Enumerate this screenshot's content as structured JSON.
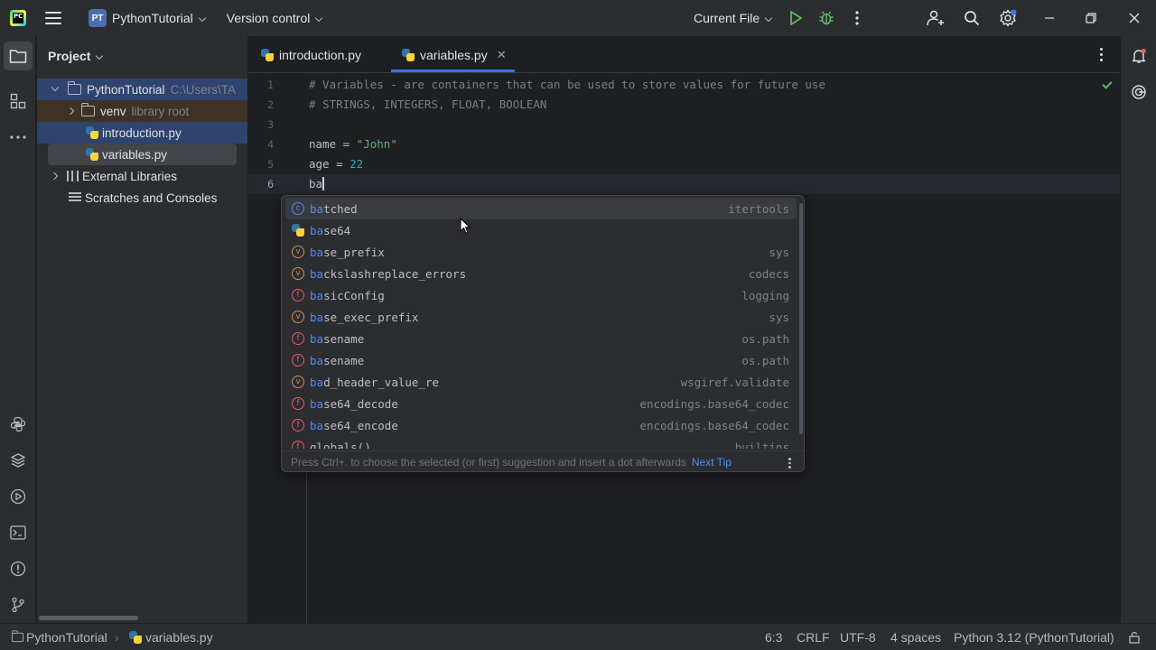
{
  "titlebar": {
    "app_logo_text": "PC",
    "project_badge": "PT",
    "project_name": "PythonTutorial",
    "vcs_label": "Version control",
    "run_config": "Current File"
  },
  "project_panel": {
    "title": "Project",
    "tree": [
      {
        "label": "PythonTutorial",
        "extra": "C:\\Users\\TA"
      },
      {
        "label": "venv",
        "extra": "library root"
      },
      {
        "label": "introduction.py",
        "extra": ""
      },
      {
        "label": "variables.py",
        "extra": ""
      },
      {
        "label": "External Libraries",
        "extra": ""
      },
      {
        "label": "Scratches and Consoles",
        "extra": ""
      }
    ]
  },
  "tabs": [
    {
      "label": "introduction.py"
    },
    {
      "label": "variables.py"
    }
  ],
  "editor": {
    "line_numbers": [
      "1",
      "2",
      "3",
      "4",
      "5",
      "6"
    ],
    "lines": {
      "l1": "# Variables - are containers that can be used to store values for future use",
      "l2": "# STRINGS, INTEGERS, FLOAT, BOOLEAN",
      "l4_var": "name = ",
      "l4_str": "\"John\"",
      "l5_var": "age = ",
      "l5_num": "22",
      "l6": "ba"
    }
  },
  "completion": {
    "items": [
      {
        "kind": "c",
        "match": "ba",
        "rest": "tched",
        "source": "itertools"
      },
      {
        "kind": "module",
        "match": "ba",
        "rest": "se64",
        "source": ""
      },
      {
        "kind": "v",
        "match": "ba",
        "rest": "se_prefix",
        "source": "sys"
      },
      {
        "kind": "v",
        "match": "ba",
        "rest": "ckslashreplace_errors",
        "source": "codecs"
      },
      {
        "kind": "f",
        "match": "ba",
        "rest": "sicConfig",
        "source": "logging"
      },
      {
        "kind": "v",
        "match": "ba",
        "rest": "se_exec_prefix",
        "source": "sys"
      },
      {
        "kind": "f",
        "match": "ba",
        "rest": "sename",
        "source": "os.path"
      },
      {
        "kind": "f",
        "match": "ba",
        "rest": "sename",
        "source": "os.path"
      },
      {
        "kind": "v",
        "match": "ba",
        "rest": "d_header_value_re",
        "source": "wsgiref.validate"
      },
      {
        "kind": "f",
        "match": "ba",
        "rest": "se64_decode",
        "source": "encodings.base64_codec"
      },
      {
        "kind": "f",
        "match": "ba",
        "rest": "se64_encode",
        "source": "encodings.base64_codec"
      },
      {
        "kind": "f",
        "match": "",
        "rest": "globals()",
        "source": "builtins"
      }
    ],
    "tip": "Press Ctrl+. to choose the selected (or first) suggestion and insert a dot afterwards",
    "next_tip": "Next Tip"
  },
  "statusbar": {
    "project": "PythonTutorial",
    "file": "variables.py",
    "position": "6:3",
    "line_sep": "CRLF",
    "encoding": "UTF-8",
    "indent": "4 spaces",
    "interpreter": "Python 3.12 (PythonTutorial)"
  },
  "colors": {
    "accent": "#3574f0",
    "background": "#1e1f22",
    "panel": "#2b2d30"
  }
}
